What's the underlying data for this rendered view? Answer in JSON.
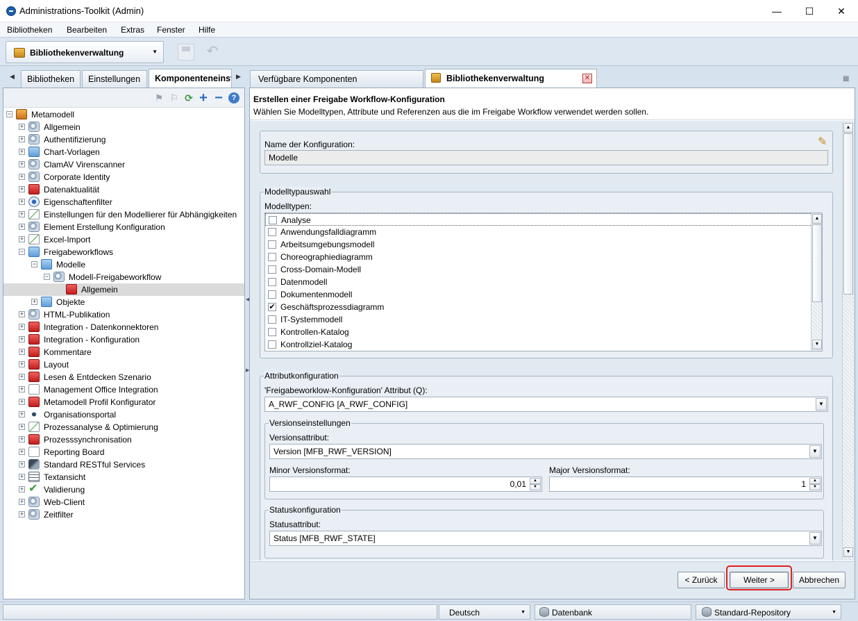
{
  "window": {
    "title": "Administrations-Toolkit (Admin)",
    "minimize": "—",
    "maximize": "☐",
    "close": "✕"
  },
  "menu": [
    "Bibliotheken",
    "Bearbeiten",
    "Extras",
    "Fenster",
    "Hilfe"
  ],
  "toolbar": {
    "perspective": "Bibliothekenverwaltung"
  },
  "left_tabs": [
    "Bibliotheken",
    "Einstellungen",
    "Komponenteneinst"
  ],
  "tree": {
    "root": "Metamodell",
    "items": [
      {
        "label": "Allgemein",
        "icon": "gear-icon"
      },
      {
        "label": "Authentifizierung",
        "icon": "gear-icon"
      },
      {
        "label": "Chart-Vorlagen",
        "icon": "folder-icon"
      },
      {
        "label": "ClamAV Virenscanner",
        "icon": "gear-icon"
      },
      {
        "label": "Corporate Identity",
        "icon": "gear-icon"
      },
      {
        "label": "Datenaktualität",
        "icon": "red-flag-icon"
      },
      {
        "label": "Eigenschaftenfilter",
        "icon": "globe-icon"
      },
      {
        "label": "Einstellungen für den Modellierer für Abhängigkeiten",
        "icon": "chart-icon"
      },
      {
        "label": "Element Erstellung Konfiguration",
        "icon": "gear-icon"
      },
      {
        "label": "Excel-Import",
        "icon": "excel-icon"
      },
      {
        "label": "Freigabeworkflows",
        "icon": "folder-icon"
      },
      {
        "label": "Modelle",
        "icon": "folder-icon"
      },
      {
        "label": "Modell-Freigabeworkflow",
        "icon": "workflow-icon"
      },
      {
        "label": "Allgemein",
        "icon": "red-flag-icon"
      },
      {
        "label": "Objekte",
        "icon": "folder-icon"
      },
      {
        "label": "HTML-Publikation",
        "icon": "gear-icon"
      },
      {
        "label": "Integration - Datenkonnektoren",
        "icon": "red-flag-icon"
      },
      {
        "label": "Integration - Konfiguration",
        "icon": "red-flag-icon"
      },
      {
        "label": "Kommentare",
        "icon": "red-flag-icon"
      },
      {
        "label": "Layout",
        "icon": "red-flag-icon"
      },
      {
        "label": "Lesen & Entdecken Szenario",
        "icon": "red-flag-icon"
      },
      {
        "label": "Management Office Integration",
        "icon": "document-icon"
      },
      {
        "label": "Metamodell Profil Konfigurator",
        "icon": "red-flag-icon"
      },
      {
        "label": "Organisationsportal",
        "icon": "eye-icon"
      },
      {
        "label": "Prozessanalyse & Optimierung",
        "icon": "chart-icon"
      },
      {
        "label": "Prozesssynchronisation",
        "icon": "red-flag-icon"
      },
      {
        "label": "Reporting Board",
        "icon": "document-icon"
      },
      {
        "label": "Standard RESTful Services",
        "icon": "plug-icon"
      },
      {
        "label": "Textansicht",
        "icon": "text-icon"
      },
      {
        "label": "Validierung",
        "icon": "check-icon"
      },
      {
        "label": "Web-Client",
        "icon": "gear-icon"
      },
      {
        "label": "Zeitfilter",
        "icon": "gear-icon"
      }
    ]
  },
  "right_tabs": [
    "Verfügbare Komponenten",
    "Bibliothekenverwaltung"
  ],
  "wizard": {
    "title": "Erstellen einer Freigabe Workflow-Konfiguration",
    "description": "Wählen Sie Modelltypen, Attribute und Referenzen aus die im Freigabe Workflow verwendet werden sollen.",
    "config_name_label": "Name der Konfiguration:",
    "config_name_value": "Modelle",
    "model_type_group": "Modelltypauswahl",
    "model_types_label": "Modelltypen:",
    "model_types": [
      {
        "label": "Analyse",
        "checked": false
      },
      {
        "label": "Anwendungsfalldiagramm",
        "checked": false
      },
      {
        "label": "Arbeitsumgebungsmodell",
        "checked": false
      },
      {
        "label": "Choreographiediagramm",
        "checked": false
      },
      {
        "label": "Cross-Domain-Modell",
        "checked": false
      },
      {
        "label": "Datenmodell",
        "checked": false
      },
      {
        "label": "Dokumentenmodell",
        "checked": false
      },
      {
        "label": "Geschäftsprozessdiagramm",
        "checked": true
      },
      {
        "label": "IT-Systemmodell",
        "checked": false
      },
      {
        "label": "Kontrollen-Katalog",
        "checked": false
      },
      {
        "label": "Kontrollziel-Katalog",
        "checked": false
      }
    ],
    "attribute_group": "Attributkonfiguration",
    "attribute_label": "'Freigabeworklow-Konfiguration' Attribut (Q):",
    "attribute_value": "A_RWF_CONFIG [A_RWF_CONFIG]",
    "version_group": "Versionseinstellungen",
    "version_attr_label": "Versionsattribut:",
    "version_attr_value": "Version [MFB_RWF_VERSION]",
    "minor_label": "Minor Versionsformat:",
    "minor_value": "0,01",
    "major_label": "Major Versionsformat:",
    "major_value": "1",
    "status_group": "Statuskonfiguration",
    "status_attr_label": "Statusattribut:",
    "status_attr_value": "Status [MFB_RWF_STATE]"
  },
  "buttons": {
    "back": "< Zurück",
    "next": "Weiter >",
    "cancel": "Abbrechen"
  },
  "statusbar": {
    "language": "Deutsch",
    "database": "Datenbank",
    "repository": "Standard-Repository"
  },
  "colors": {
    "highlight": "#e02020",
    "panel_bg": "#e1e9f1",
    "selection": "#dbdbdb"
  }
}
